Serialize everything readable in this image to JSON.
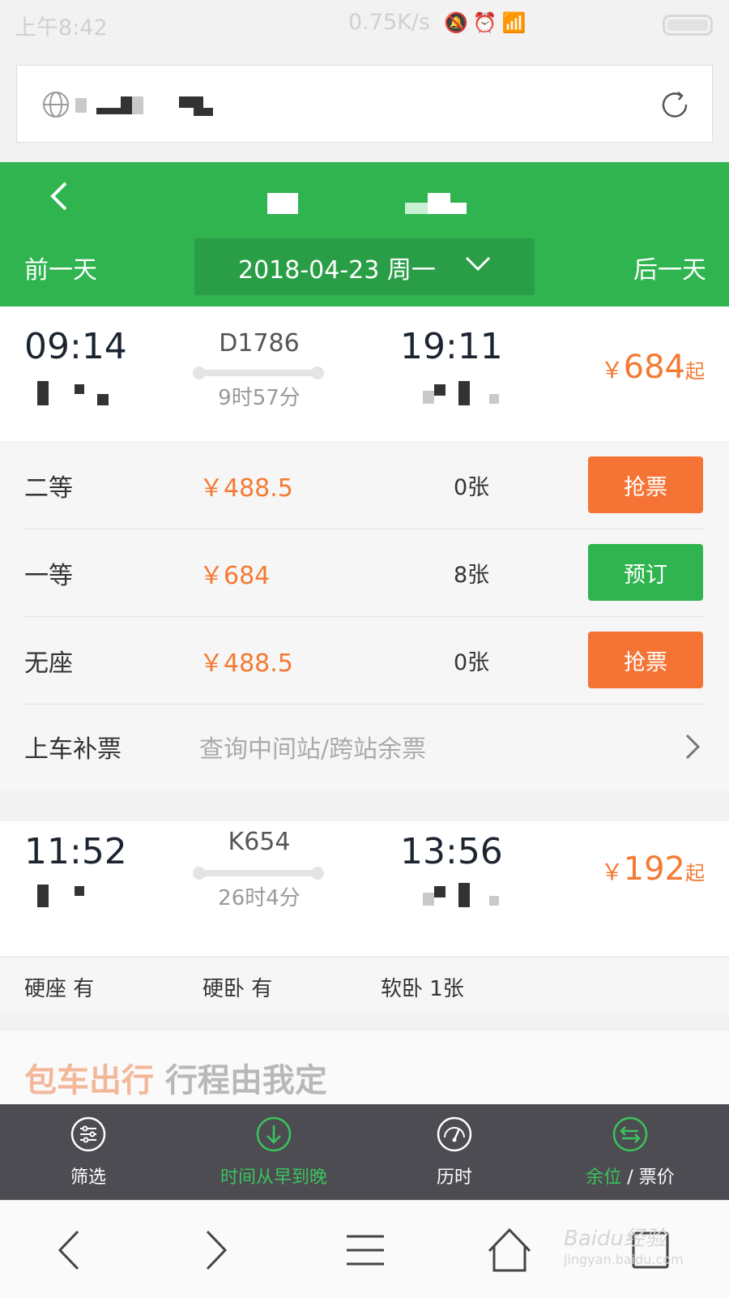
{
  "status_bar": {
    "time": "上午8:42",
    "network_speed": "0.75K/s"
  },
  "header": {
    "prev_day": "前一天",
    "next_day": "后一天",
    "date": "2018-04-23 周一"
  },
  "trains": [
    {
      "departure_time": "09:14",
      "train_no": "D1786",
      "duration": "9时57分",
      "arrival_time": "19:11",
      "price_symbol": "￥",
      "price": "684",
      "price_suffix": "起",
      "seats": [
        {
          "type": "二等",
          "price": "￥488.5",
          "count": "0张",
          "action": "抢票"
        },
        {
          "type": "一等",
          "price": "￥684",
          "count": "8张",
          "action": "预订"
        },
        {
          "type": "无座",
          "price": "￥488.5",
          "count": "0张",
          "action": "抢票"
        }
      ],
      "transfer": {
        "label": "上车补票",
        "hint": "查询中间站/跨站余票"
      }
    },
    {
      "departure_time": "11:52",
      "train_no": "K654",
      "duration": "26时4分",
      "arrival_time": "13:56",
      "price_symbol": "￥",
      "price": "192",
      "price_suffix": "起",
      "seat_summary": [
        "硬座 有",
        "硬卧 有",
        "软卧 1张"
      ]
    }
  ],
  "ad": {
    "text_orange": "包车出行",
    "text_dark": "行程由我定"
  },
  "filter_bar": {
    "filter": "筛选",
    "sort_time": "时间从早到晚",
    "duration": "历时",
    "seats_label": "余位",
    "separator": "/",
    "price_label": "票价"
  },
  "watermark": {
    "brand": "Baidu经验",
    "site": "jingyan.baidu.com"
  },
  "colors": {
    "primary_green": "#2fb44f",
    "price_orange": "#f47a33",
    "grab_button": "#f57335",
    "filter_bar_bg": "#4c4c52"
  }
}
